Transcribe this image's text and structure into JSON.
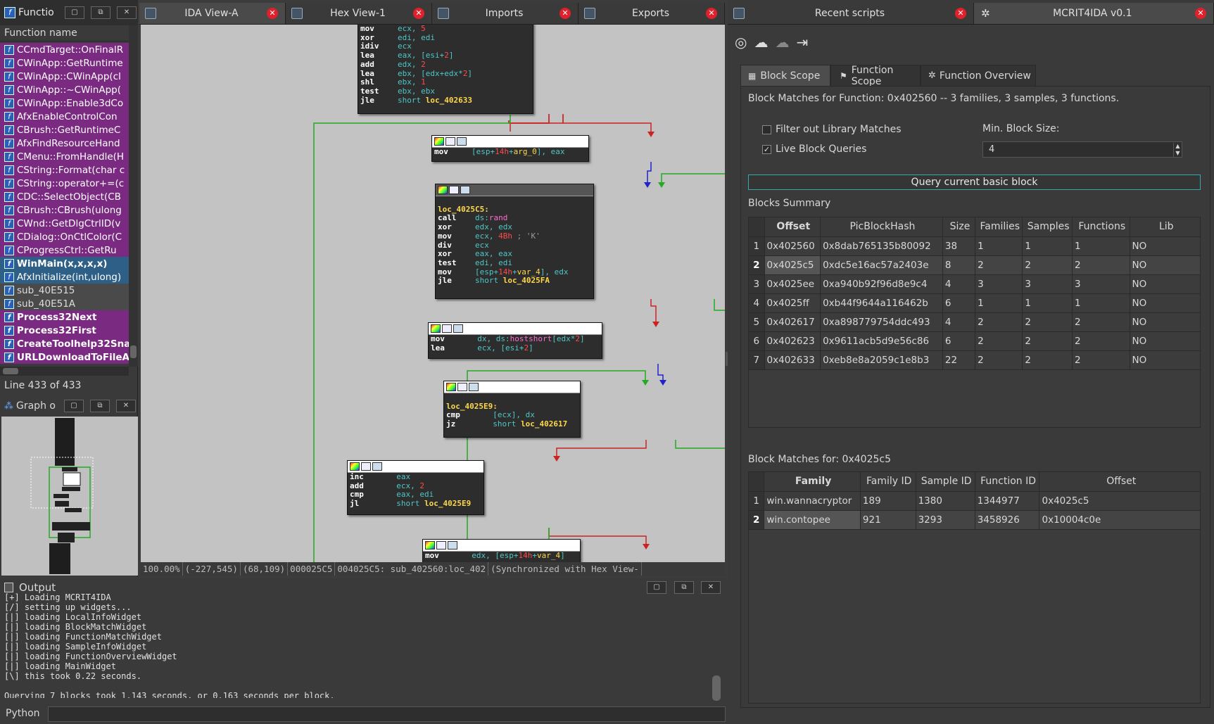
{
  "functions_panel": {
    "title": "Functio",
    "header": "Function name",
    "status": "Line 433 of 433",
    "items": [
      {
        "name": "CCmdTarget::OnFinalR",
        "style": "lib"
      },
      {
        "name": "CWinApp::GetRuntime",
        "style": "lib"
      },
      {
        "name": "CWinApp::CWinApp(cl",
        "style": "lib"
      },
      {
        "name": "CWinApp::~CWinApp(",
        "style": "lib"
      },
      {
        "name": "CWinApp::Enable3dCo",
        "style": "lib"
      },
      {
        "name": "AfxEnableControlCon",
        "style": "lib"
      },
      {
        "name": "CBrush::GetRuntimeC",
        "style": "lib"
      },
      {
        "name": "AfxFindResourceHand",
        "style": "lib"
      },
      {
        "name": "CMenu::FromHandle(H",
        "style": "lib"
      },
      {
        "name": "CString::Format(char c",
        "style": "lib"
      },
      {
        "name": "CString::operator+=(c",
        "style": "lib"
      },
      {
        "name": "CDC::SelectObject(CB",
        "style": "lib"
      },
      {
        "name": "CBrush::CBrush(ulong",
        "style": "lib"
      },
      {
        "name": "CWnd::GetDlgCtrlID(v",
        "style": "lib"
      },
      {
        "name": "CDialog::OnCtlColor(C",
        "style": "lib"
      },
      {
        "name": "CProgressCtrl::GetRu",
        "style": "lib"
      },
      {
        "name": "WinMain(x,x,x,x)",
        "style": "selected"
      },
      {
        "name": "AfxInitialize(int,ulong)",
        "style": "selected2"
      },
      {
        "name": "sub_40E515",
        "style": "plain"
      },
      {
        "name": "sub_40E51A",
        "style": "plain"
      },
      {
        "name": "Process32Next",
        "style": "libbold"
      },
      {
        "name": "Process32First",
        "style": "libbold"
      },
      {
        "name": "CreateToolhelp32Sna",
        "style": "libbold"
      },
      {
        "name": "URLDownloadToFileA",
        "style": "libbold"
      }
    ]
  },
  "graph_overview": {
    "title": "Graph o"
  },
  "tabs_center": [
    {
      "label": "IDA View-A"
    },
    {
      "label": "Hex View-1"
    },
    {
      "label": "Imports"
    },
    {
      "label": "Exports"
    }
  ],
  "tabs_right": [
    {
      "label": "Recent scripts"
    },
    {
      "label": "MCRIT4IDA v0.1"
    }
  ],
  "graph_status": [
    "100.00%",
    "(-227,545)",
    "(68,109)",
    "000025C5",
    "004025C5: sub_402560:loc_402",
    "(Synchronized with Hex View-"
  ],
  "code_blocks": {
    "b1": [
      [
        "mov",
        "ecx, 5"
      ],
      [
        "xor",
        "edi, edi"
      ],
      [
        "idiv",
        "ecx"
      ],
      [
        "lea",
        "eax, [esi+2]"
      ],
      [
        "add",
        "edx, 2"
      ],
      [
        "lea",
        "ebx, [edx+edx*2]"
      ],
      [
        "shl",
        "ebx, 1"
      ],
      [
        "test",
        "ebx, ebx"
      ],
      [
        "jle",
        "short loc_402633"
      ]
    ],
    "b2": [
      [
        "mov",
        "[esp+14h+arg_0], eax"
      ]
    ],
    "b3_label": "loc_4025C5:",
    "b3": [
      [
        "call",
        "ds:rand"
      ],
      [
        "xor",
        "edx, edx"
      ],
      [
        "mov",
        "ecx, 4Bh ; 'K'"
      ],
      [
        "div",
        "ecx"
      ],
      [
        "xor",
        "eax, eax"
      ],
      [
        "test",
        "edi, edi"
      ],
      [
        "mov",
        "[esp+14h+var_4], edx"
      ],
      [
        "jle",
        "short loc_4025FA"
      ]
    ],
    "b4": [
      [
        "mov",
        "dx, ds:hostshort[edx*2]"
      ],
      [
        "lea",
        "ecx, [esi+2]"
      ]
    ],
    "b5_label": "loc_4025E9:",
    "b5": [
      [
        "cmp",
        "[ecx], dx"
      ],
      [
        "jz",
        "short loc_402617"
      ]
    ],
    "b6": [
      [
        "inc",
        "eax"
      ],
      [
        "add",
        "ecx, 2"
      ],
      [
        "cmp",
        "eax, edi"
      ],
      [
        "jl",
        "short loc_4025E9"
      ]
    ],
    "b7": [
      [
        "mov",
        "edx, [esp+14h+var_4]"
      ]
    ]
  },
  "output": {
    "title": "Output",
    "lines": [
      "[+] Loading MCRIT4IDA",
      "[/] setting up widgets...",
      "[|] loading LocalInfoWidget",
      "[|] loading BlockMatchWidget",
      "[|] loading FunctionMatchWidget",
      "[|] loading SampleInfoWidget",
      "[|] loading FunctionOverviewWidget",
      "[|] loading MainWidget",
      "[\\] this took 0.22 seconds.",
      "",
      "Querying 7 blocks took 1.143 seconds, or 0.163 seconds per block."
    ],
    "input_label": "Python"
  },
  "mcrit": {
    "subtabs": [
      {
        "label": "Block Scope"
      },
      {
        "label": "Function Scope"
      },
      {
        "label": "Function Overview"
      }
    ],
    "info": "Block Matches for Function: 0x402560 -- 3 families, 3 samples, 3 functions.",
    "filter_label": "Filter out Library Matches",
    "live_label": "Live Block Queries",
    "min_block_label": "Min. Block Size:",
    "min_block_value": "4",
    "query_button": "Query current basic block",
    "summary_title": "Blocks Summary",
    "summary_columns": [
      "Offset",
      "PicBlockHash",
      "Size",
      "Families",
      "Samples",
      "Functions",
      "Lib"
    ],
    "summary_rows": [
      [
        "0x402560",
        "0x8dab765135b80092",
        "38",
        "1",
        "1",
        "1",
        "NO"
      ],
      [
        "0x4025c5",
        "0xdc5e16ac57a2403e",
        "8",
        "2",
        "2",
        "2",
        "NO"
      ],
      [
        "0x4025ee",
        "0xa940b92f96d8e9c4",
        "4",
        "3",
        "3",
        "3",
        "NO"
      ],
      [
        "0x4025ff",
        "0xb44f9644a116462b",
        "6",
        "1",
        "1",
        "1",
        "NO"
      ],
      [
        "0x402617",
        "0xa898779754ddc493",
        "4",
        "2",
        "2",
        "2",
        "NO"
      ],
      [
        "0x402623",
        "0x9611acb5d9e56c86",
        "6",
        "2",
        "2",
        "2",
        "NO"
      ],
      [
        "0x402633",
        "0xeb8e8a2059c1e8b3",
        "22",
        "2",
        "2",
        "2",
        "NO"
      ]
    ],
    "matches_title": "Block Matches for: 0x4025c5",
    "matches_columns": [
      "Family",
      "Family ID",
      "Sample ID",
      "Function ID",
      "Offset"
    ],
    "matches_rows": [
      [
        "win.wannacryptor",
        "189",
        "1380",
        "1344977",
        "0x4025c5"
      ],
      [
        "win.contopee",
        "921",
        "3293",
        "3458926",
        "0x10004c0e"
      ]
    ]
  }
}
